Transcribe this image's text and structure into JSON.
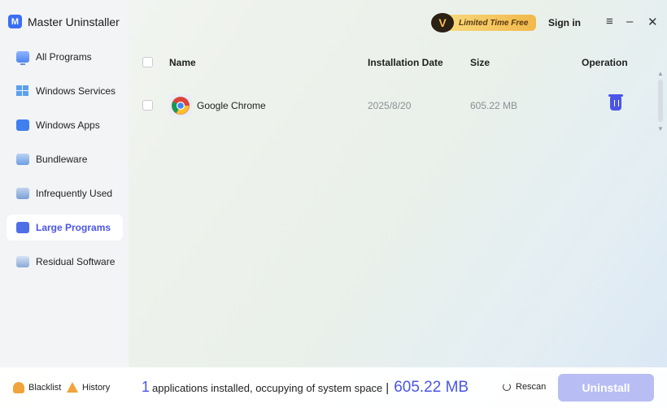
{
  "app": {
    "title": "Master Uninstaller",
    "logo_letter": "M"
  },
  "header": {
    "promo_badge": "V",
    "promo_label": "Limited Time Free",
    "signin": "Sign in",
    "menu_icon": "≡",
    "minimize_icon": "–",
    "close_icon": "✕"
  },
  "sidebar": {
    "items": [
      {
        "label": "All Programs",
        "icon": "monitor-icon"
      },
      {
        "label": "Windows Services",
        "icon": "windows-icon"
      },
      {
        "label": "Windows Apps",
        "icon": "apps-icon"
      },
      {
        "label": "Bundleware",
        "icon": "bundle-icon"
      },
      {
        "label": "Infrequently Used",
        "icon": "calendar-icon"
      },
      {
        "label": "Large Programs",
        "icon": "large-programs-icon",
        "active": true
      },
      {
        "label": "Residual Software",
        "icon": "residual-icon"
      }
    ]
  },
  "table": {
    "columns": {
      "name": "Name",
      "date": "Installation Date",
      "size": "Size",
      "operation": "Operation"
    },
    "rows": [
      {
        "name": "Google Chrome",
        "date": "2025/8/20",
        "size": "605.22 MB",
        "icon": "chrome-icon"
      }
    ]
  },
  "footer": {
    "blacklist": "Blacklist",
    "history": "History",
    "count": "1",
    "summary_text": "applications installed, occupying of system space",
    "separator": "|",
    "total_size": "605.22 MB",
    "rescan": "Rescan",
    "uninstall": "Uninstall"
  },
  "colors": {
    "accent": "#4a55e8",
    "promo": "#f2b84a",
    "uninstall_disabled": "#b8bdf3",
    "warning": "#f0a43b"
  }
}
